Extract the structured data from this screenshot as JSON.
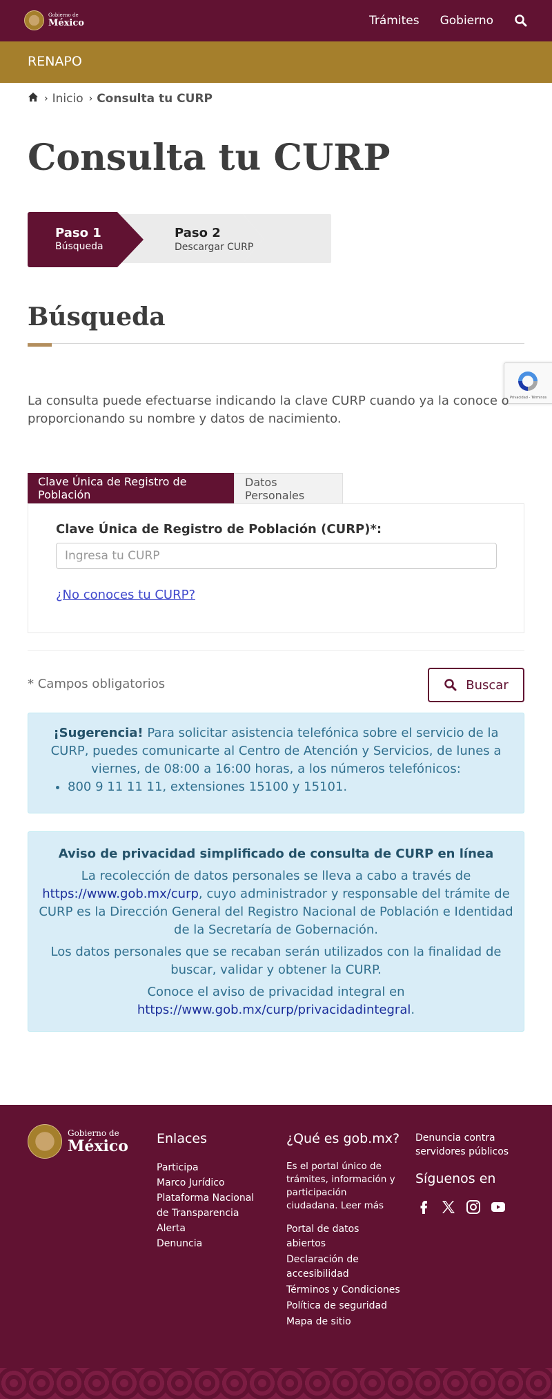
{
  "header": {
    "brand_line1": "Gobierno de",
    "brand_line2": "México",
    "nav": [
      "Trámites",
      "Gobierno"
    ]
  },
  "subheader": {
    "title": "RENAPO"
  },
  "breadcrumb": {
    "home": "Inicio",
    "current": "Consulta tu CURP"
  },
  "page": {
    "title": "Consulta tu CURP"
  },
  "stepper": {
    "steps": [
      {
        "title": "Paso 1",
        "subtitle": "Búsqueda"
      },
      {
        "title": "Paso 2",
        "subtitle": "Descargar CURP"
      }
    ]
  },
  "section": {
    "title": "Búsqueda",
    "intro": "La consulta puede efectuarse indicando la clave CURP cuando ya la conoce o proporcionando su nombre y datos de nacimiento."
  },
  "tabs": {
    "active": "Clave Única de Registro de Población",
    "inactive": "Datos Personales"
  },
  "form": {
    "label": "Clave Única de Registro de Población (CURP)*:",
    "placeholder": "Ingresa tu CURP",
    "value": "",
    "help_link": "¿No conoces tu CURP?",
    "required_note": "* Campos obligatorios",
    "search_button": "Buscar"
  },
  "recaptcha": {
    "text": "Privacidad - Términos"
  },
  "suggestion": {
    "strong": "¡Sugerencia!",
    "text": " Para solicitar asistencia telefónica sobre el servicio de la CURP, puedes comunicarte al Centro de Atención y Servicios, de lunes a viernes, de 08:00 a 16:00 horas, a los números telefónicos:",
    "items": [
      "800 9 11 11 11, extensiones 15100 y 15101."
    ]
  },
  "privacy": {
    "heading": "Aviso de privacidad simplificado de consulta de CURP en línea",
    "p1_before": "La recolección de datos personales se lleva a cabo a través de ",
    "p1_link": "https://www.gob.mx/curp",
    "p1_after": ", cuyo administrador y responsable del trámite de CURP es la Dirección General del Registro Nacional de Población e Identidad de la Secretaría de Gobernación.",
    "p2": "Los datos personales que se recaban serán utilizados con la finalidad de buscar, validar y obtener la CURP.",
    "p3_before": "Conoce el aviso de privacidad integral en ",
    "p3_link": "https://www.gob.mx/curp/privacidadintegral",
    "p3_after": "."
  },
  "footer": {
    "brand_line1": "Gobierno de",
    "brand_line2": "México",
    "links_title": "Enlaces",
    "links": [
      "Participa",
      "Marco Jurídico",
      "Plataforma Nacional de Transparencia",
      "Alerta",
      "Denuncia"
    ],
    "what_title": "¿Qué es gob.mx?",
    "what_desc": "Es el portal único de trámites, información y participación ciudadana.",
    "read_more": "Leer más",
    "what_links": [
      "Portal de datos abiertos",
      "Declaración de accesibilidad",
      "Términos y Condiciones",
      "Política de seguridad",
      "Mapa de sitio"
    ],
    "denuncia": "Denuncia contra servidores públicos",
    "follow_title": "Síguenos en"
  },
  "colors": {
    "primary": "#611232",
    "gold": "#a57f2c",
    "alert_bg": "#d9edf7",
    "alert_text": "#31708f"
  },
  "icons": [
    "home-icon",
    "chevron-right-icon",
    "search-icon",
    "facebook-icon",
    "x-icon",
    "instagram-icon",
    "youtube-icon",
    "recaptcha-icon"
  ]
}
